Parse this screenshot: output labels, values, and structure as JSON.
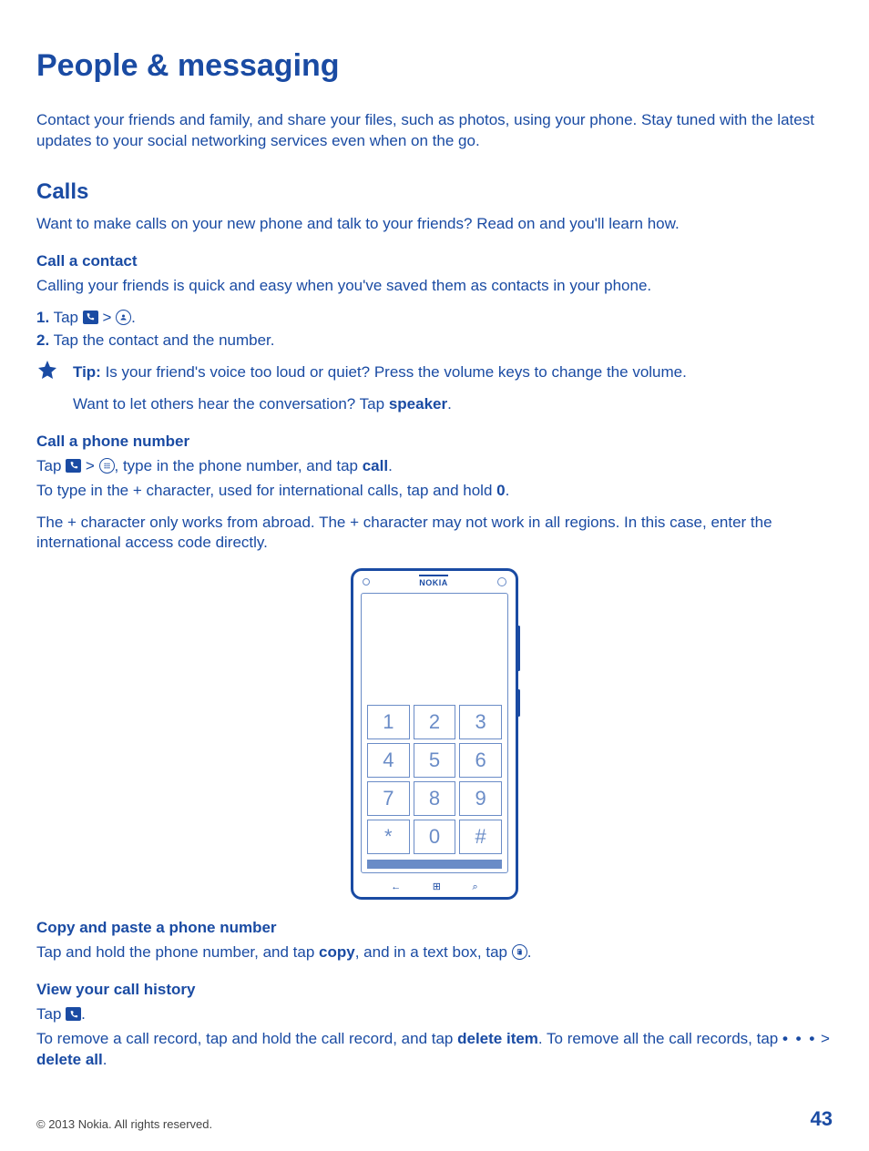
{
  "title": "People & messaging",
  "intro": "Contact your friends and family, and share your files, such as photos, using your phone. Stay tuned with the latest updates to your social networking services even when on the go.",
  "calls": {
    "heading": "Calls",
    "intro": "Want to make calls on your new phone and talk to your friends? Read on and you'll learn how."
  },
  "call_contact": {
    "heading": "Call a contact",
    "intro": "Calling your friends is quick and easy when you've saved them as contacts in your phone.",
    "step1_prefix": "1.",
    "step1_tap": " Tap ",
    "step1_gt": " > ",
    "step1_dot": ".",
    "step2_prefix": "2.",
    "step2_text": " Tap the contact and the number.",
    "tip_label": "Tip:",
    "tip_text": " Is your friend's voice too loud or quiet? Press the volume keys to change the volume.",
    "tip_line2a": "Want to let others hear the conversation? Tap ",
    "tip_speaker": "speaker",
    "tip_line2b": "."
  },
  "call_number": {
    "heading": "Call a phone number",
    "line1_a": "Tap ",
    "line1_gt": " > ",
    "line1_b": ", type in the phone number, and tap ",
    "line1_call": "call",
    "line1_c": ".",
    "line2_a": "To type in the + character, used for international calls, tap and hold ",
    "line2_zero": "0",
    "line2_b": ".",
    "line3": "The + character only works from abroad. The + character may not work in all regions. In this case, enter the international access code directly."
  },
  "phone": {
    "brand": "NOKIA",
    "keys": [
      "1",
      "2",
      "3",
      "4",
      "5",
      "6",
      "7",
      "8",
      "9",
      "*",
      "0",
      "#"
    ],
    "nav_back": "←",
    "nav_home": "⊞",
    "nav_search": "⌕"
  },
  "copy_paste": {
    "heading": "Copy and paste a phone number",
    "a": "Tap and hold the phone number, and tap ",
    "copy": "copy",
    "b": ", and in a text box, tap ",
    "c": "."
  },
  "history": {
    "heading": "View your call history",
    "tap": "Tap ",
    "dot": ".",
    "p_a": "To remove a call record, tap and hold the call record, and tap ",
    "delete_item": "delete item",
    "p_b": ". To remove all the call records, tap  ",
    "p_c": "  > ",
    "delete_all": "delete all",
    "p_d": "."
  },
  "more_dots": "• • •",
  "footer": {
    "copyright": "© 2013 Nokia. All rights reserved.",
    "page": "43"
  }
}
